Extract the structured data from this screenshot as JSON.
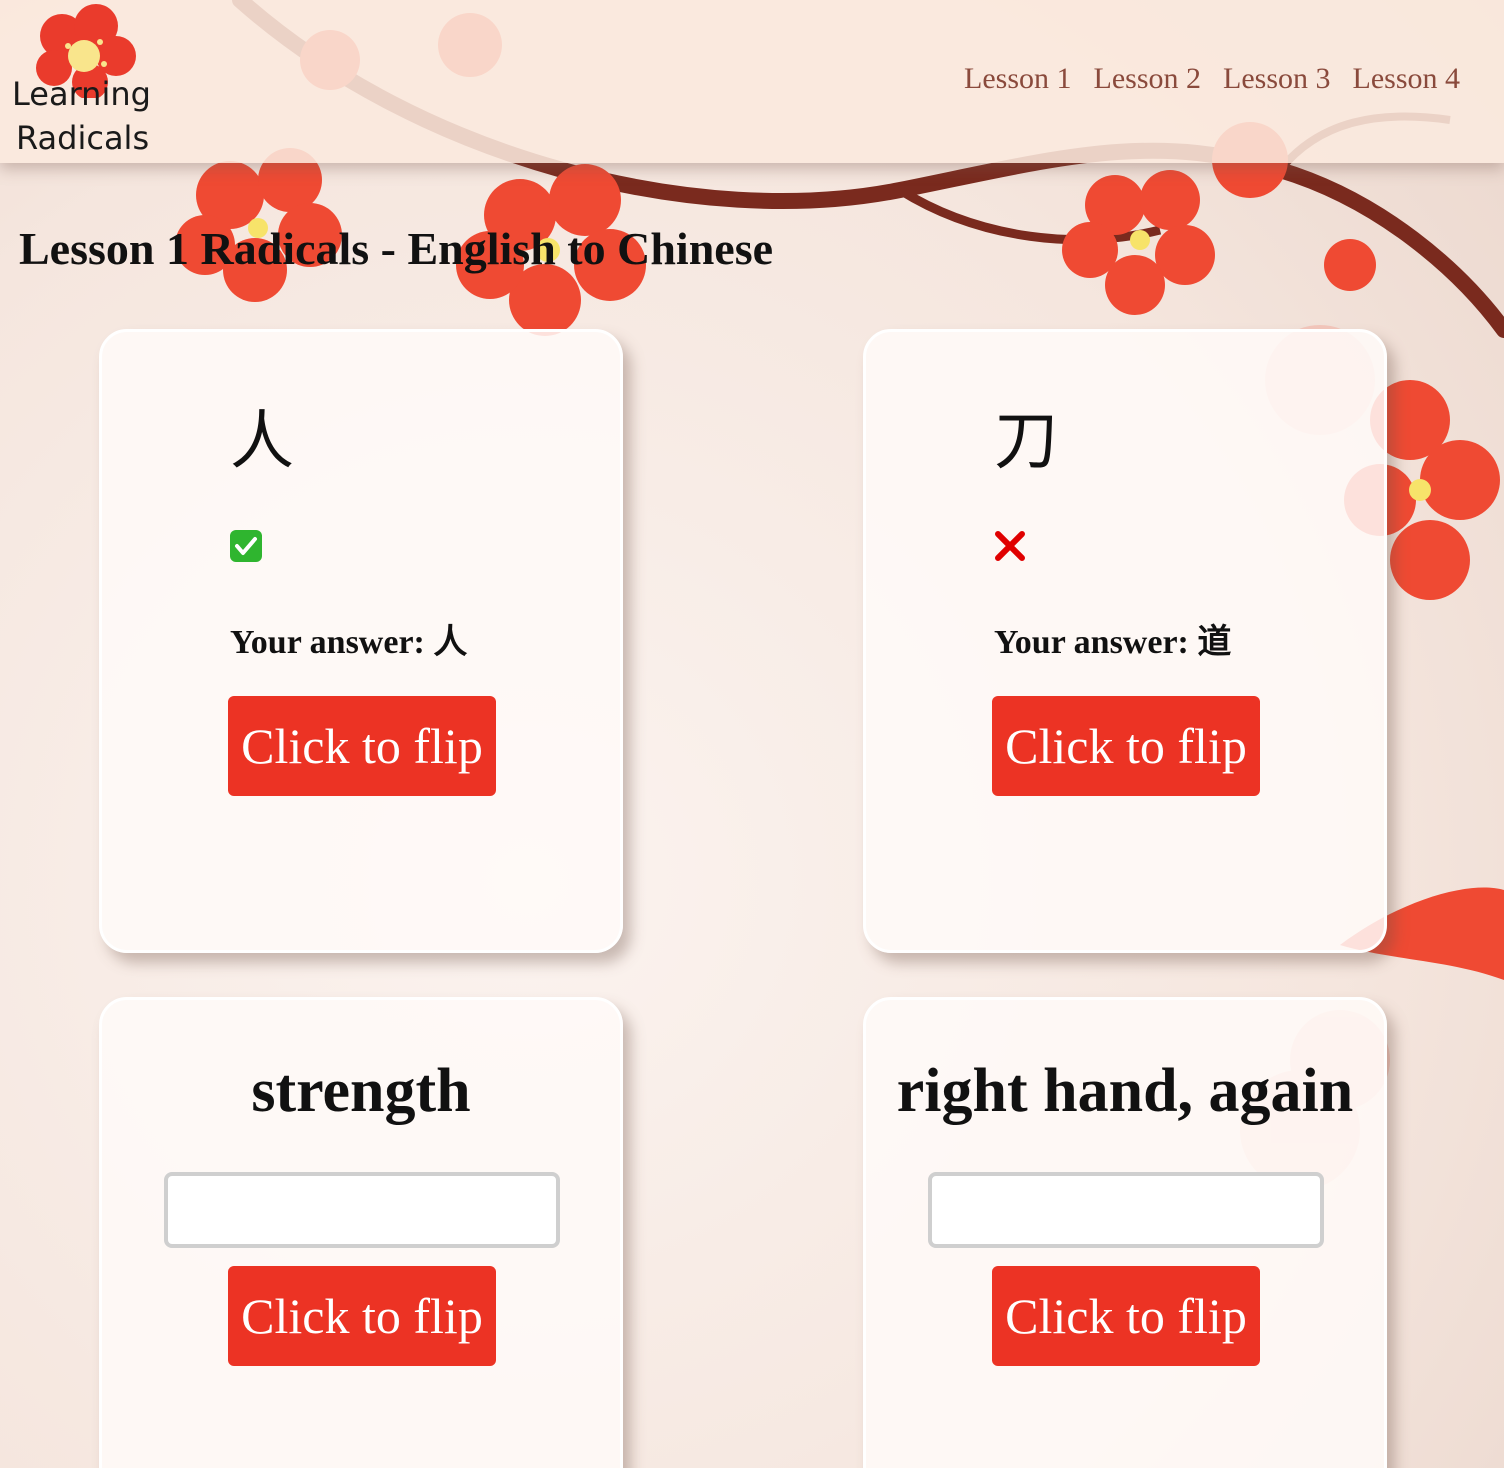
{
  "brand": {
    "line1": "Learning",
    "line2": "Radicals"
  },
  "nav": [
    {
      "label": "Lesson 1"
    },
    {
      "label": "Lesson 2"
    },
    {
      "label": "Lesson 3"
    },
    {
      "label": "Lesson 4"
    }
  ],
  "page_title": "Lesson 1 Radicals - English to Chinese",
  "cards": [
    {
      "glyph": "人",
      "result": "correct",
      "answer_label": "Your answer: 人",
      "button_label": "Click to flip"
    },
    {
      "glyph": "刀",
      "result": "incorrect",
      "answer_label": "Your answer: 道",
      "button_label": "Click to flip"
    },
    {
      "prompt": "strength",
      "input_value": "",
      "button_label": "Click to flip"
    },
    {
      "prompt": "right hand, again",
      "input_value": "",
      "button_label": "Click to flip"
    }
  ],
  "icons": {
    "correct": "check-mark-icon",
    "incorrect": "cross-mark-icon",
    "logo": "plum-blossom-icon"
  },
  "colors": {
    "button": "#ec3324",
    "nav_link": "#8a4a3c",
    "check_green": "#2fb52f",
    "cross_red": "#e00000"
  }
}
